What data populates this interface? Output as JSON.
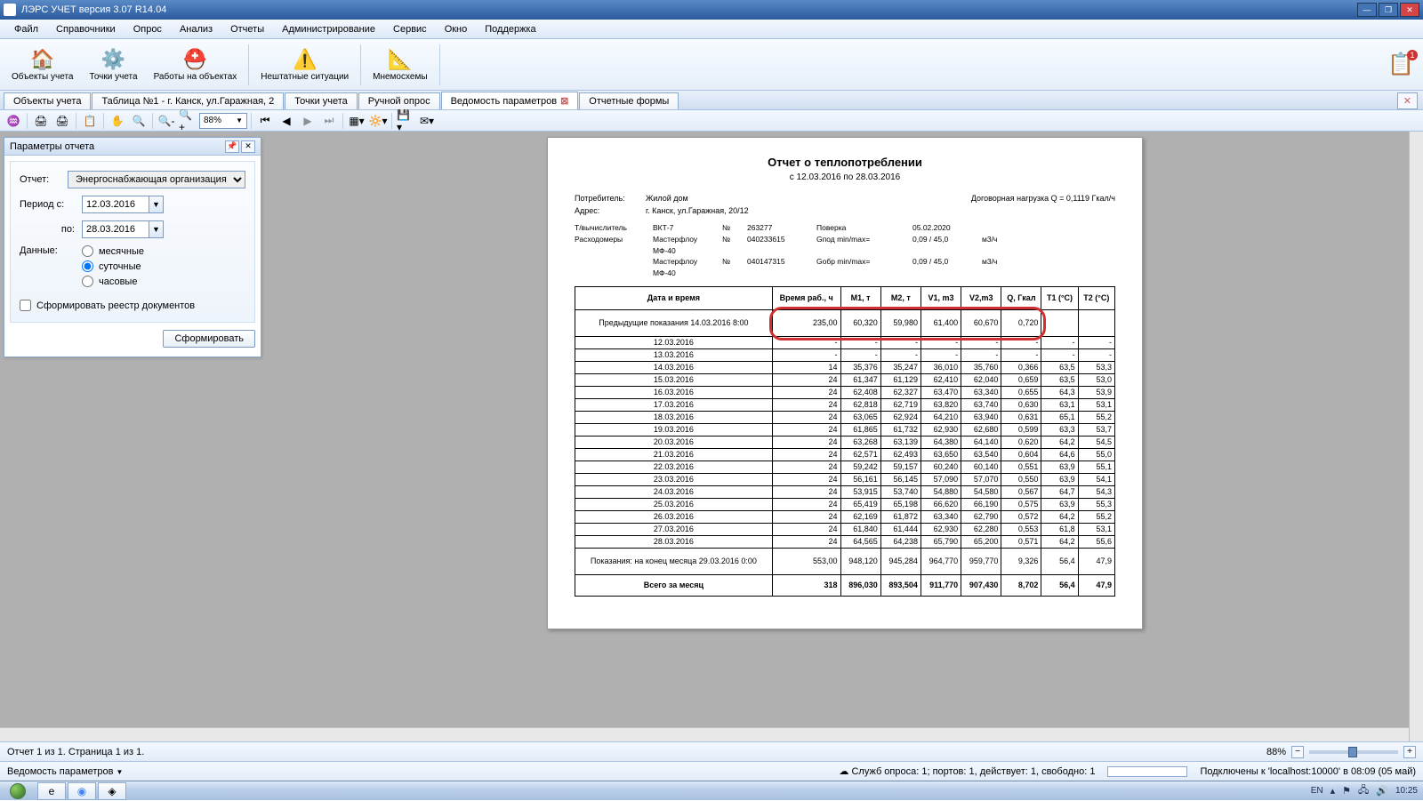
{
  "window": {
    "title": "ЛЭРС УЧЕТ версия 3.07 R14.04"
  },
  "menu": [
    "Файл",
    "Справочники",
    "Опрос",
    "Анализ",
    "Отчеты",
    "Администрирование",
    "Сервис",
    "Окно",
    "Поддержка"
  ],
  "ribbon": [
    {
      "label": "Объекты учета",
      "icon": "🏠"
    },
    {
      "label": "Точки учета",
      "icon": "⚙️"
    },
    {
      "label": "Работы на объектах",
      "icon": "⛑️"
    },
    {
      "label": "Нештатные ситуации",
      "icon": "⚠️"
    },
    {
      "label": "Мнемосхемы",
      "icon": "📐"
    }
  ],
  "tabs": [
    "Объекты учета",
    "Таблица №1 - г. Канск, ул.Гаражная, 2",
    "Точки учета",
    "Ручной опрос",
    "Ведомость параметров",
    "Отчетные формы"
  ],
  "active_tab_index": 4,
  "toolbar2": {
    "zoom": "88%"
  },
  "params": {
    "panel_title": "Параметры отчета",
    "report_label": "Отчет:",
    "report_value": "Энергоснабжающая организация",
    "period_from_label": "Период с:",
    "period_from": "12.03.2016",
    "period_to_label": "по:",
    "period_to": "28.03.2016",
    "data_label": "Данные:",
    "radios": [
      "месячные",
      "суточные",
      "часовые"
    ],
    "radio_selected": 1,
    "checkbox": "Сформировать реестр документов",
    "form_btn": "Сформировать"
  },
  "report": {
    "title": "Отчет о теплопотреблении",
    "date_line": "с    12.03.2016    по    28.03.2016",
    "consumer_label": "Потребитель:",
    "consumer": "Жилой дом",
    "address_label": "Адрес:",
    "address": "г. Канск, ул.Гаражная, 20/12",
    "contract": "Договорная нагрузка  Q  =   0,1119  Гкал/ч",
    "devices": [
      {
        "l": "Т/вычислитель",
        "m": "ВКТ-7",
        "n": "№",
        "num": "263277",
        "p": "Поверка",
        "pv": "05.02.2020"
      },
      {
        "l": "Расходомеры",
        "m": "Мастерфлоу МФ-40",
        "n": "№",
        "num": "040233615",
        "p": "Gпод min/max=",
        "pv": "0,09 / 45,0",
        "u": "м3/ч"
      },
      {
        "l": "",
        "m": "Мастерфлоу МФ-40",
        "n": "№",
        "num": "040147315",
        "p": "Gобр min/max=",
        "pv": "0,09 / 45,0",
        "u": "м3/ч"
      }
    ],
    "columns": [
      "Дата и время",
      "Время раб., ч",
      "M1, т",
      "M2, т",
      "V1, m3",
      "V2,m3",
      "Q, Гкал",
      "T1 (°C)",
      "T2 (°C)"
    ],
    "prev_label": "Предыдущие показания 14.03.2016  8:00",
    "prev_row": [
      "235,00",
      "60,320",
      "59,980",
      "61,400",
      "60,670",
      "0,720",
      "",
      ""
    ],
    "rows": [
      [
        "12.03.2016",
        "-",
        "-",
        "-",
        "-",
        "-",
        "-",
        "-",
        "-"
      ],
      [
        "13.03.2016",
        "-",
        "-",
        "-",
        "-",
        "-",
        "-",
        "-",
        "-"
      ],
      [
        "14.03.2016",
        "14",
        "35,376",
        "35,247",
        "36,010",
        "35,760",
        "0,366",
        "63,5",
        "53,3"
      ],
      [
        "15.03.2016",
        "24",
        "61,347",
        "61,129",
        "62,410",
        "62,040",
        "0,659",
        "63,5",
        "53,0"
      ],
      [
        "16.03.2016",
        "24",
        "62,408",
        "62,327",
        "63,470",
        "63,340",
        "0,655",
        "64,3",
        "53,9"
      ],
      [
        "17.03.2016",
        "24",
        "62,818",
        "62,719",
        "63,820",
        "63,740",
        "0,630",
        "63,1",
        "53,1"
      ],
      [
        "18.03.2016",
        "24",
        "63,065",
        "62,924",
        "64,210",
        "63,940",
        "0,631",
        "65,1",
        "55,2"
      ],
      [
        "19.03.2016",
        "24",
        "61,865",
        "61,732",
        "62,930",
        "62,680",
        "0,599",
        "63,3",
        "53,7"
      ],
      [
        "20.03.2016",
        "24",
        "63,268",
        "63,139",
        "64,380",
        "64,140",
        "0,620",
        "64,2",
        "54,5"
      ],
      [
        "21.03.2016",
        "24",
        "62,571",
        "62,493",
        "63,650",
        "63,540",
        "0,604",
        "64,6",
        "55,0"
      ],
      [
        "22.03.2016",
        "24",
        "59,242",
        "59,157",
        "60,240",
        "60,140",
        "0,551",
        "63,9",
        "55,1"
      ],
      [
        "23.03.2016",
        "24",
        "56,161",
        "56,145",
        "57,090",
        "57,070",
        "0,550",
        "63,9",
        "54,1"
      ],
      [
        "24.03.2016",
        "24",
        "53,915",
        "53,740",
        "54,880",
        "54,580",
        "0,567",
        "64,7",
        "54,3"
      ],
      [
        "25.03.2016",
        "24",
        "65,419",
        "65,198",
        "66,620",
        "66,190",
        "0,575",
        "63,9",
        "55,3"
      ],
      [
        "26.03.2016",
        "24",
        "62,169",
        "61,872",
        "63,340",
        "62,790",
        "0,572",
        "64,2",
        "55,2"
      ],
      [
        "27.03.2016",
        "24",
        "61,840",
        "61,444",
        "62,930",
        "62,280",
        "0,553",
        "61,8",
        "53,1"
      ],
      [
        "28.03.2016",
        "24",
        "64,565",
        "64,238",
        "65,790",
        "65,200",
        "0,571",
        "64,2",
        "55,6"
      ]
    ],
    "end_label": "Показания: на конец месяца 29.03.2016  0:00",
    "end_row": [
      "553,00",
      "948,120",
      "945,284",
      "964,770",
      "959,770",
      "9,326",
      "56,4",
      "47,9"
    ],
    "total_label": "Всего за месяц",
    "total_row": [
      "318",
      "896,030",
      "893,504",
      "911,770",
      "907,430",
      "8,702",
      "56,4",
      "47,9"
    ]
  },
  "status1": {
    "left": "Отчет 1 из 1.  Страница 1 из 1.",
    "zoom": "88%"
  },
  "status2": {
    "left": "Ведомость параметров",
    "services": "Служб опроса: 1; портов: 1, действует: 1, свободно: 1",
    "conn": "Подключены к 'localhost:10000' в 08:09 (05 май)"
  },
  "taskbar": {
    "lang": "EN",
    "time": "10:25"
  }
}
